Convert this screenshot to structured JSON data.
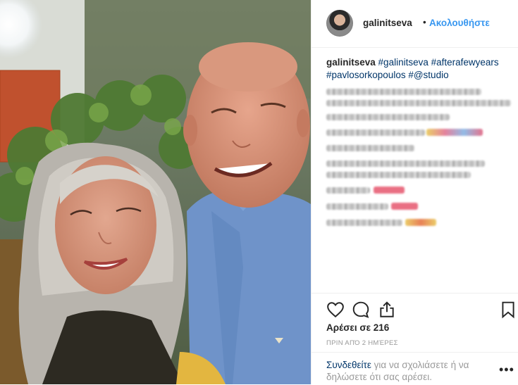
{
  "post": {
    "username": "galinitseva",
    "separator": "•",
    "follow_label": "Ακολουθήστε",
    "caption": {
      "username": "galinitseva",
      "hashtag_1": "#galinitseva",
      "hashtag_2": "#afterafewyears",
      "hashtag_3": "#pavlosorkopoulos",
      "hashtag_4": "#@studio"
    },
    "likes_text": "Αρέσει σε 216",
    "timestamp": "ΠΡΙΝ ΑΠΌ 2 ΗΜΈΡΕΣ",
    "footer": {
      "login_link": "Συνδεθείτε",
      "login_rest": " για να σχολιάσετε ή να δηλώσετε ότι σας αρέσει.",
      "more_label": "•••"
    }
  },
  "icons": {
    "like": "heart-icon",
    "comment": "comment-icon",
    "share": "share-icon",
    "save": "bookmark-icon"
  },
  "colors": {
    "link_blue": "#3897f0",
    "hashtag": "#003569",
    "muted": "#999999",
    "text": "#262626"
  }
}
